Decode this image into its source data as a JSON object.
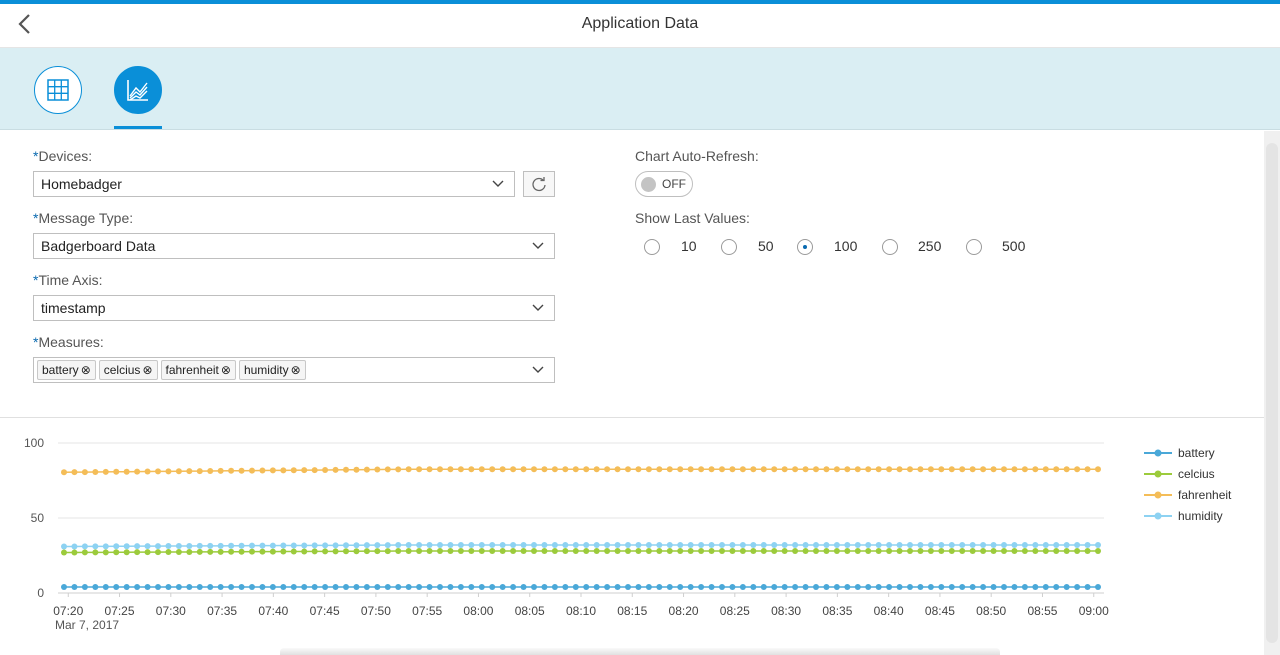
{
  "header": {
    "title": "Application Data"
  },
  "tabs": [
    {
      "name": "table",
      "active": false
    },
    {
      "name": "chart",
      "active": true
    }
  ],
  "form": {
    "devices": {
      "label": "Devices:",
      "value": "Homebadger"
    },
    "message_type": {
      "label": "Message Type:",
      "value": "Badgerboard Data"
    },
    "time_axis": {
      "label": "Time Axis:",
      "value": "timestamp"
    },
    "measures": {
      "label": "Measures:",
      "tokens": [
        "battery",
        "celcius",
        "fahrenheit",
        "humidity"
      ]
    },
    "required_marker": "*",
    "auto_refresh": {
      "label": "Chart Auto-Refresh:",
      "state": "OFF"
    },
    "show_last": {
      "label": "Show Last Values:",
      "options": [
        "10",
        "50",
        "100",
        "250",
        "500"
      ],
      "selected": "100"
    }
  },
  "colors": {
    "accent": "#0a8fd8",
    "battery": "#4aa8d8",
    "celcius": "#9ccb3c",
    "fahrenheit": "#f4bd58",
    "humidity": "#8dd2f2"
  },
  "chart_data": {
    "type": "line",
    "ylim": [
      0,
      100
    ],
    "yticks": [
      "100",
      "50",
      "0"
    ],
    "x_ticks": [
      "07:20",
      "07:25",
      "07:30",
      "07:35",
      "07:40",
      "07:45",
      "07:50",
      "07:55",
      "08:00",
      "08:05",
      "08:10",
      "08:15",
      "08:20",
      "08:25",
      "08:30",
      "08:35",
      "08:40",
      "08:45",
      "08:50",
      "08:55",
      "09:00"
    ],
    "x_date": "Mar 7, 2017",
    "x_range": [
      "07:19",
      "09:01"
    ],
    "points_per_series": 100,
    "legend_position": "right",
    "series": [
      {
        "name": "battery",
        "color": "#4aa8d8",
        "start": 4,
        "end": 4
      },
      {
        "name": "celcius",
        "color": "#9ccb3c",
        "start": 27,
        "end": 28
      },
      {
        "name": "fahrenheit",
        "color": "#f4bd58",
        "start": 80.5,
        "end": 82.5
      },
      {
        "name": "humidity",
        "color": "#8dd2f2",
        "start": 31,
        "end": 32
      }
    ]
  }
}
